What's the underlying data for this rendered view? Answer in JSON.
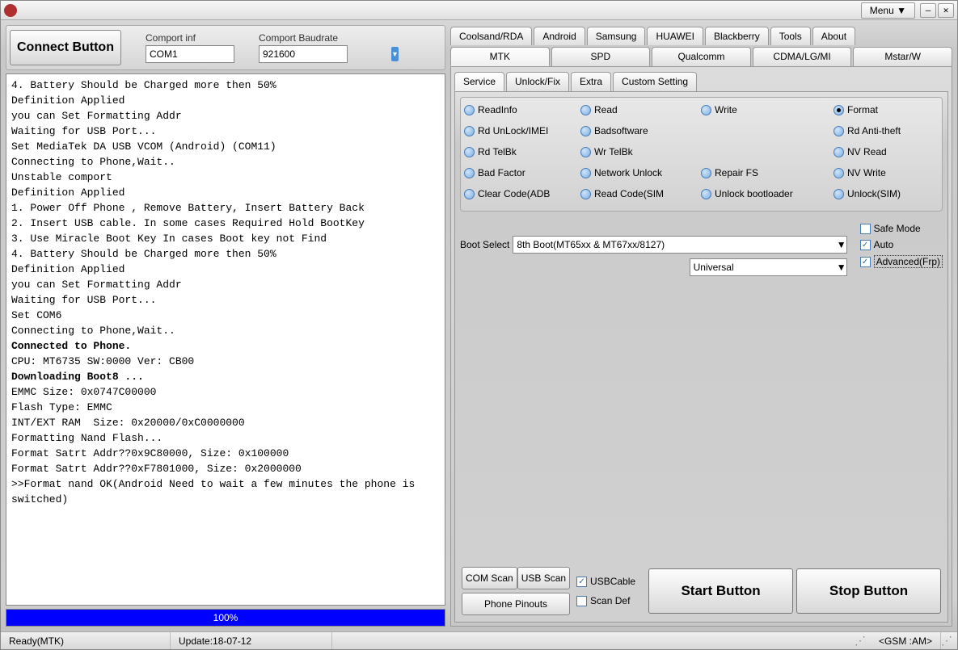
{
  "titlebar": {
    "menu": "Menu ▼"
  },
  "top": {
    "connect": "Connect Button",
    "comport_label": "Comport inf",
    "comport_value": "COM1",
    "baud_label": "Comport Baudrate",
    "baud_value": "921600"
  },
  "log": {
    "lines": [
      {
        "t": "4. Battery Should be Charged more then 50%",
        "b": false
      },
      {
        "t": "Definition Applied",
        "b": false
      },
      {
        "t": "you can Set Formatting Addr",
        "b": false
      },
      {
        "t": "Waiting for USB Port...",
        "b": false
      },
      {
        "t": "Set MediaTek DA USB VCOM (Android) (COM11)",
        "b": false
      },
      {
        "t": "Connecting to Phone,Wait..",
        "b": false
      },
      {
        "t": "Unstable comport",
        "b": false
      },
      {
        "t": "Definition Applied",
        "b": false
      },
      {
        "t": "1. Power Off Phone , Remove Battery, Insert Battery Back",
        "b": false
      },
      {
        "t": "2. Insert USB cable. In some cases Required Hold BootKey",
        "b": false
      },
      {
        "t": "3. Use Miracle Boot Key In cases Boot key not Find",
        "b": false
      },
      {
        "t": "4. Battery Should be Charged more then 50%",
        "b": false
      },
      {
        "t": "Definition Applied",
        "b": false
      },
      {
        "t": "you can Set Formatting Addr",
        "b": false
      },
      {
        "t": "Waiting for USB Port...",
        "b": false
      },
      {
        "t": "Set COM6",
        "b": false
      },
      {
        "t": "Connecting to Phone,Wait..",
        "b": false
      },
      {
        "t": "Connected to Phone.",
        "b": true
      },
      {
        "t": "CPU: MT6735 SW:0000 Ver: CB00",
        "b": false
      },
      {
        "t": "Downloading Boot8 ...",
        "b": true
      },
      {
        "t": "EMMC Size: 0x0747C00000",
        "b": false
      },
      {
        "t": "Flash Type: EMMC",
        "b": false
      },
      {
        "t": "INT/EXT RAM  Size: 0x20000/0xC0000000",
        "b": false
      },
      {
        "t": "Formatting Nand Flash...",
        "b": false
      },
      {
        "t": "Format Satrt Addr??0x9C80000, Size: 0x100000",
        "b": false
      },
      {
        "t": "Format Satrt Addr??0xF7801000, Size: 0x2000000",
        "b": false
      },
      {
        "t": ">>Format nand OK(Android Need to wait a few minutes the phone is switched)",
        "b": false
      }
    ]
  },
  "progress": {
    "percent": "100%",
    "width": "100%"
  },
  "tabs_top": [
    "Coolsand/RDA",
    "Android",
    "Samsung",
    "HUAWEI",
    "Blackberry",
    "Tools",
    "About"
  ],
  "tabs_main": [
    "MTK",
    "SPD",
    "Qualcomm",
    "CDMA/LG/MI",
    "Mstar/W"
  ],
  "tabs_sub": [
    "Service",
    "Unlock/Fix",
    "Extra",
    "Custom Setting"
  ],
  "radios": [
    {
      "label": "ReadInfo",
      "sel": false
    },
    {
      "label": "Read",
      "sel": false
    },
    {
      "label": "Write",
      "sel": false
    },
    {
      "label": "Format",
      "sel": true
    },
    {
      "label": "Rd UnLock/IMEI",
      "sel": false
    },
    {
      "label": "Badsoftware",
      "sel": false
    },
    {
      "label": "",
      "sel": false,
      "empty": true
    },
    {
      "label": "Rd Anti-theft",
      "sel": false
    },
    {
      "label": "Rd TelBk",
      "sel": false
    },
    {
      "label": "Wr TelBk",
      "sel": false
    },
    {
      "label": "",
      "sel": false,
      "empty": true
    },
    {
      "label": "NV Read",
      "sel": false
    },
    {
      "label": "Bad Factor",
      "sel": false
    },
    {
      "label": "Network Unlock",
      "sel": false
    },
    {
      "label": "Repair FS",
      "sel": false
    },
    {
      "label": "NV Write",
      "sel": false
    },
    {
      "label": "Clear Code(ADB",
      "sel": false
    },
    {
      "label": "Read Code(SIM",
      "sel": false
    },
    {
      "label": "Unlock bootloader",
      "sel": false
    },
    {
      "label": "Unlock(SIM)",
      "sel": false
    }
  ],
  "boot": {
    "label": "Boot Select",
    "value": "8th Boot(MT65xx & MT67xx/8127)",
    "value2": "Universal",
    "safe": "Safe Mode",
    "auto": "Auto",
    "frp": "Advanced(Frp)"
  },
  "bottom": {
    "comscan": "COM Scan",
    "usbscan": "USB Scan",
    "pinouts": "Phone Pinouts",
    "usbcable": "USBCable",
    "scandef": "Scan Def",
    "start": "Start Button",
    "stop": "Stop Button"
  },
  "status": {
    "ready": "Ready(MTK)",
    "update": "Update:18-07-12",
    "right": "<GSM :AM>"
  }
}
